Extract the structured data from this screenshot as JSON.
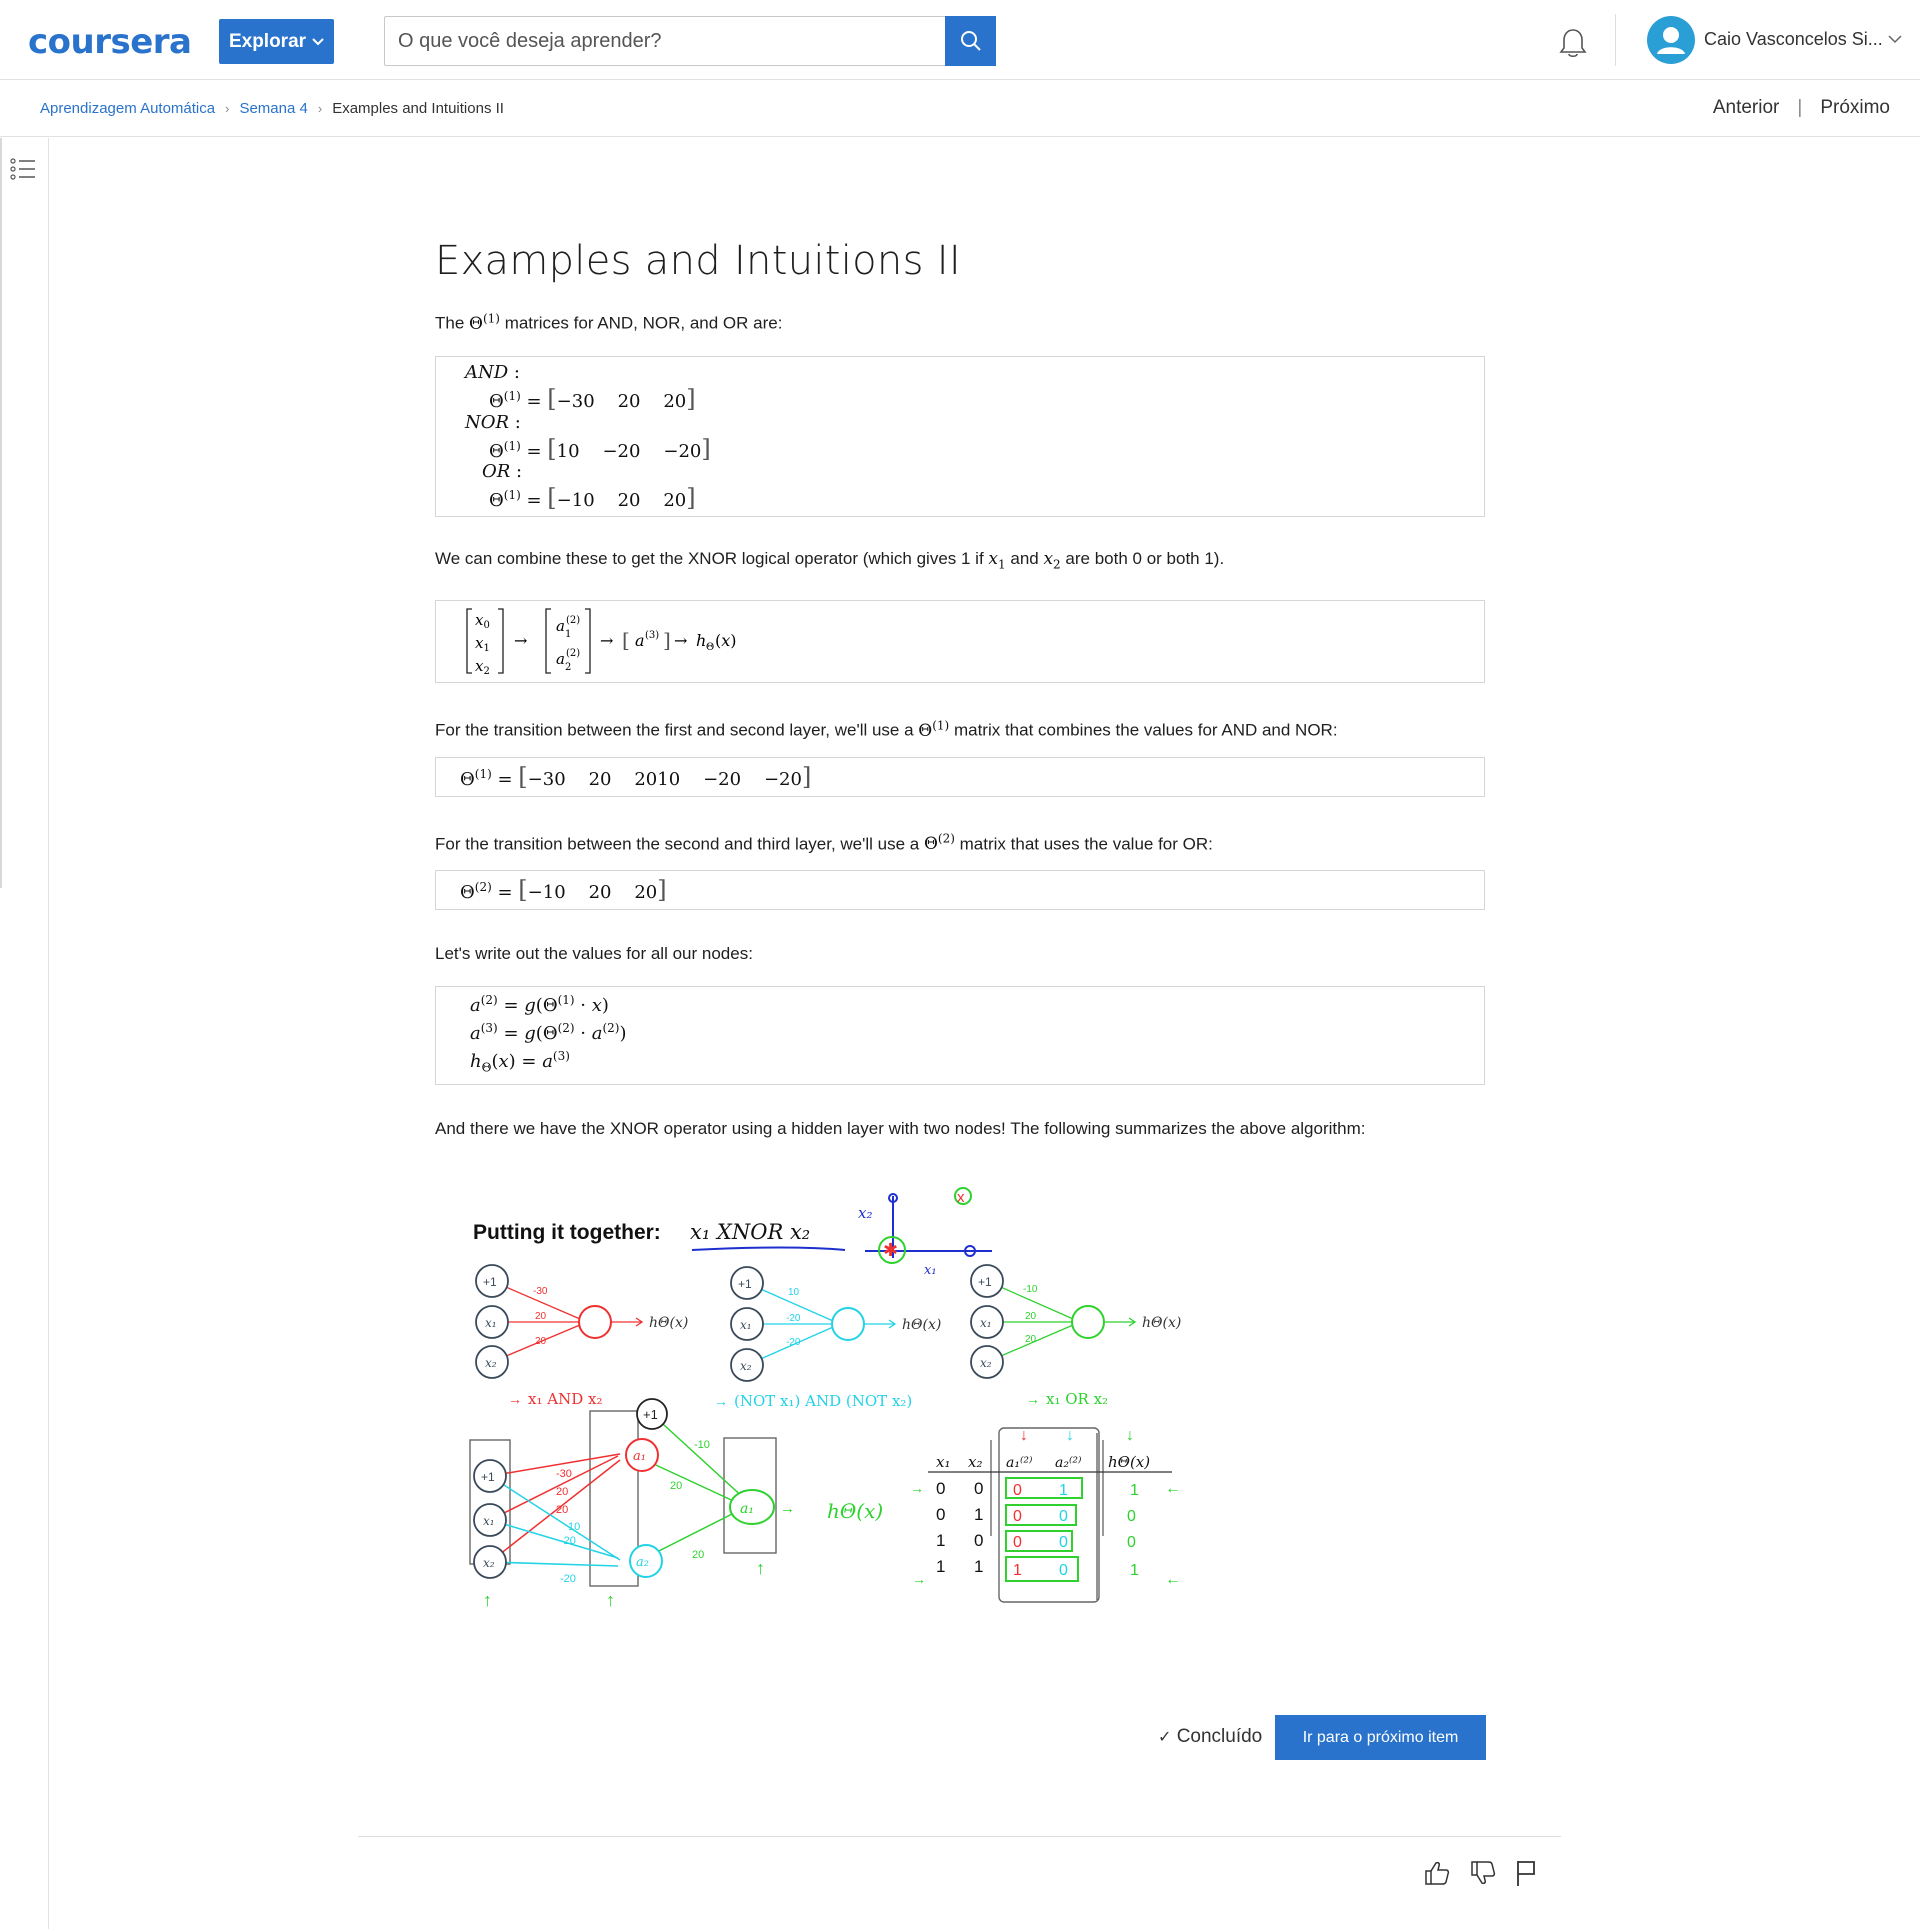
{
  "header": {
    "logo": "coursera",
    "explore_label": "Explorar",
    "search_placeholder": "O que você deseja aprender?",
    "username": "Caio Vasconcelos Si...",
    "brand_color": "#2a73cc"
  },
  "breadcrumb": {
    "course": "Aprendizagem Automática",
    "week": "Semana 4",
    "current": "Examples and Intuitions II",
    "prev": "Anterior",
    "next": "Próximo"
  },
  "article": {
    "title": "Examples and Intuitions II",
    "p1_a": "The ",
    "p1_b": " matrices for AND, NOR, and OR are:",
    "m1": {
      "and_label": "AND",
      "and_vals": [
        "−30",
        "20",
        "20"
      ],
      "nor_label": "NOR",
      "nor_vals": [
        "10",
        "−20",
        "−20"
      ],
      "or_label": "OR",
      "or_vals": [
        "−10",
        "20",
        "20"
      ]
    },
    "p2_a": "We can combine these to get the XNOR logical operator (which gives 1 if ",
    "p2_b": " and ",
    "p2_c": " are both 0 or both 1).",
    "p3_a": "For the transition between the first and second layer, we'll use a ",
    "p3_b": " matrix that combines the values for AND and NOR:",
    "m3_vals": [
      "−30",
      "20",
      "2010",
      "−20",
      "−20"
    ],
    "p4_a": "For the transition between the second and third layer, we'll use a ",
    "p4_b": " matrix that uses the value for OR:",
    "m4_vals": [
      "−10",
      "20",
      "20"
    ],
    "p5": "Let's write out the values for all our nodes:",
    "p6": "And there we have the XNOR operator using a hidden layer with two nodes! The following summarizes the above algorithm:"
  },
  "figure": {
    "title_bold": "Putting it together:",
    "title_math": "x₁ XNOR x₂",
    "net1_weights": [
      "-30",
      "20",
      "20"
    ],
    "net2_weights": [
      "10",
      "-20",
      "-20"
    ],
    "net3_weights": [
      "-10",
      "20",
      "20"
    ],
    "net1_caption": "x₁ AND x₂",
    "net2_caption": "(NOT x₁) AND (NOT x₂)",
    "net3_caption": "x₁ OR x₂",
    "output_label": "hΘ(x)",
    "bias_label": "+1",
    "in1_label": "x₁",
    "in2_label": "x₂",
    "table_headers": [
      "x₁",
      "x₂",
      "a₁⁽²⁾",
      "a₂⁽²⁾",
      "hΘ(x)"
    ],
    "table_rows": [
      [
        "0",
        "0",
        "0",
        "1",
        "1"
      ],
      [
        "0",
        "1",
        "0",
        "0",
        "0"
      ],
      [
        "1",
        "0",
        "0",
        "0",
        "0"
      ],
      [
        "1",
        "1",
        "1",
        "0",
        "1"
      ]
    ],
    "colors": {
      "and": "#f03030",
      "nor": "#22d3e6",
      "or": "#2ed12e",
      "ink": "#3a4a5a"
    }
  },
  "actions": {
    "done": "Concluído",
    "next_item": "Ir para o próximo item"
  }
}
